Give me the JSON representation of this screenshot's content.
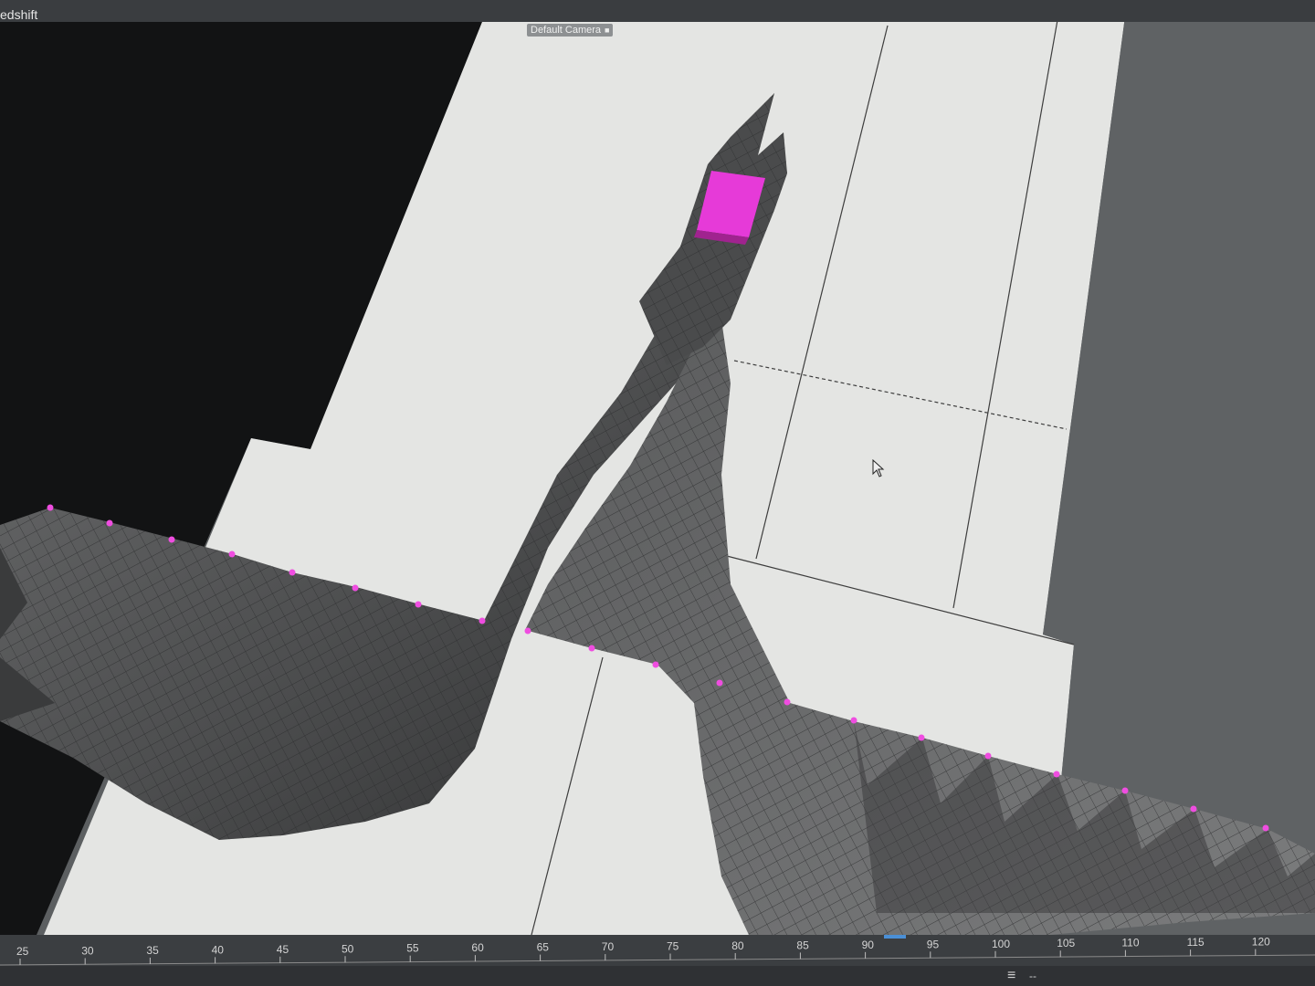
{
  "app": {
    "title": "edshift"
  },
  "viewport": {
    "camera_label": "Default Camera",
    "camera_icon": "camera-icon",
    "colors": {
      "background_plane": "#e4e5e3",
      "mesh": "#58595a",
      "mesh_dark": "#3a3b3c",
      "accent": "#e63ad8",
      "dark_area": "#111213"
    }
  },
  "timeline": {
    "tick_labels": [
      "25",
      "30",
      "35",
      "40",
      "45",
      "50",
      "55",
      "60",
      "65",
      "70",
      "75",
      "80",
      "85",
      "90",
      "95",
      "100",
      "105",
      "110",
      "115",
      "120"
    ],
    "current_frame": "91"
  },
  "statusbar": {
    "menu_icon": "hamburger-menu-icon",
    "status_text": "--"
  }
}
